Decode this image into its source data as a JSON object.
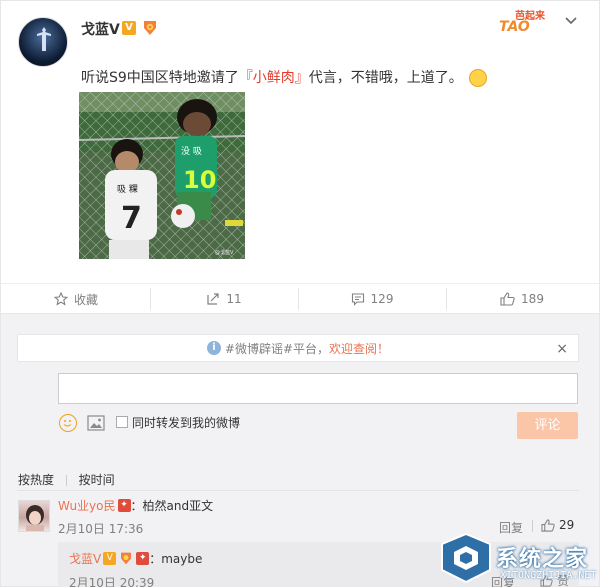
{
  "post": {
    "username": "戈蓝V",
    "verified_badge": "V",
    "medal_icon": "fan-medal-icon",
    "event_logo_top": "芭起来",
    "event_logo_main": "TAO",
    "menu_icon": "chevron-down-icon",
    "text_before": "听说S9中国区特地邀请了",
    "keyword": "『小鲜肉』",
    "text_after": "代言，不错哦，上道了。",
    "image_alt": "两个穿着球衣的小男孩靠在铁丝网前",
    "image_jersey_left": "吸 粿",
    "image_number_left": "7",
    "image_jersey_right": "没 吸",
    "image_number_right": "10",
    "image_watermark": "@戈蓝V"
  },
  "actions": {
    "favorite_label": "收藏",
    "forward_count": "11",
    "comment_count": "129",
    "like_count": "189"
  },
  "notice": {
    "prefix": "#微博辟谣#平台，",
    "link": "欢迎查阅！",
    "close": "×"
  },
  "composer": {
    "input_value": "",
    "forward_label": "同时转发到我的微博",
    "submit_label": "评论"
  },
  "sort": {
    "hot": "按热度",
    "time": "按时间"
  },
  "comments": [
    {
      "name": "Wu业yo民",
      "text": "：柏然and亚文",
      "time": "2月10日 17:36",
      "reply": "回复",
      "likes": "29"
    }
  ],
  "sub_comment": {
    "name": "戈蓝V",
    "text": "：maybe",
    "time": "2月10日 20:39",
    "reply": "回复",
    "like_label": "赞"
  },
  "watermark": {
    "main": "系统之家",
    "sub": "XITONGZHIJIA.NET"
  },
  "colors": {
    "accent": "#eb7350",
    "keyword": "#e03c2e",
    "submit_disabled": "#fbc5a8",
    "background_comments": "#f2f2f5"
  }
}
